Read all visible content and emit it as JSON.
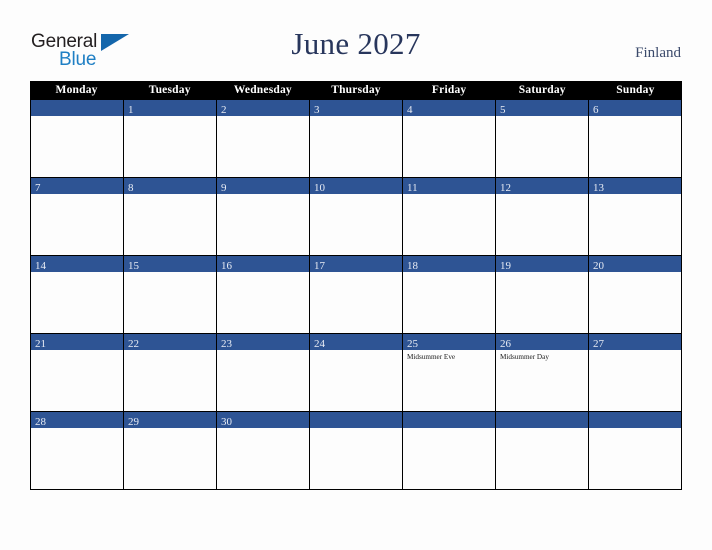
{
  "brand": {
    "name_part1": "General",
    "name_part2": "Blue",
    "triangle_color": "#1466ab",
    "blue_color": "#1f7fc4"
  },
  "header": {
    "title": "June 2027",
    "country": "Finland",
    "title_color": "#28365c"
  },
  "calendar": {
    "weekday_headers": [
      "Monday",
      "Tuesday",
      "Wednesday",
      "Thursday",
      "Friday",
      "Saturday",
      "Sunday"
    ],
    "header_bg": "#000000",
    "daybar_bg": "#2e5494",
    "cell_bg": "#fdfdfd",
    "weeks": [
      [
        {
          "day": "",
          "events": []
        },
        {
          "day": "1",
          "events": []
        },
        {
          "day": "2",
          "events": []
        },
        {
          "day": "3",
          "events": []
        },
        {
          "day": "4",
          "events": []
        },
        {
          "day": "5",
          "events": []
        },
        {
          "day": "6",
          "events": []
        }
      ],
      [
        {
          "day": "7",
          "events": []
        },
        {
          "day": "8",
          "events": []
        },
        {
          "day": "9",
          "events": []
        },
        {
          "day": "10",
          "events": []
        },
        {
          "day": "11",
          "events": []
        },
        {
          "day": "12",
          "events": []
        },
        {
          "day": "13",
          "events": []
        }
      ],
      [
        {
          "day": "14",
          "events": []
        },
        {
          "day": "15",
          "events": []
        },
        {
          "day": "16",
          "events": []
        },
        {
          "day": "17",
          "events": []
        },
        {
          "day": "18",
          "events": []
        },
        {
          "day": "19",
          "events": []
        },
        {
          "day": "20",
          "events": []
        }
      ],
      [
        {
          "day": "21",
          "events": []
        },
        {
          "day": "22",
          "events": []
        },
        {
          "day": "23",
          "events": []
        },
        {
          "day": "24",
          "events": []
        },
        {
          "day": "25",
          "events": [
            "Midsummer Eve"
          ]
        },
        {
          "day": "26",
          "events": [
            "Midsummer Day"
          ]
        },
        {
          "day": "27",
          "events": []
        }
      ],
      [
        {
          "day": "28",
          "events": []
        },
        {
          "day": "29",
          "events": []
        },
        {
          "day": "30",
          "events": []
        },
        {
          "day": "",
          "events": []
        },
        {
          "day": "",
          "events": []
        },
        {
          "day": "",
          "events": []
        },
        {
          "day": "",
          "events": []
        }
      ]
    ]
  }
}
